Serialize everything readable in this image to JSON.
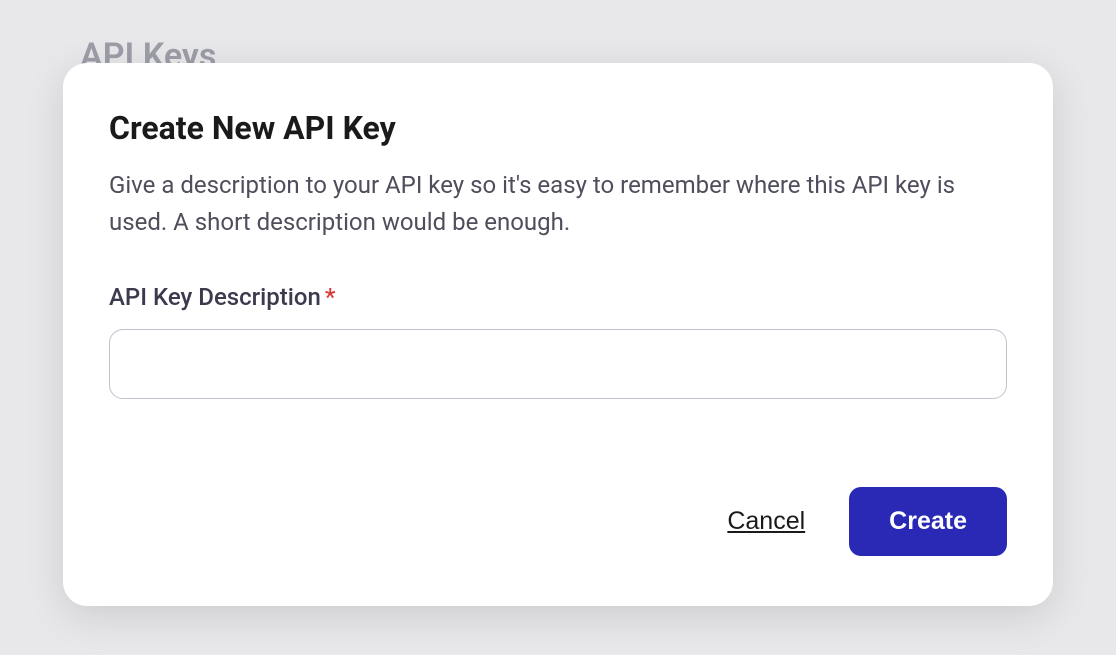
{
  "page": {
    "title": "API Keys"
  },
  "modal": {
    "title": "Create New API Key",
    "description": "Give a description to your API key so it's easy to remember where this API key is used. A short description would be enough.",
    "field": {
      "label": "API Key Description",
      "required_marker": "*",
      "value": ""
    },
    "actions": {
      "cancel_label": "Cancel",
      "create_label": "Create"
    }
  }
}
